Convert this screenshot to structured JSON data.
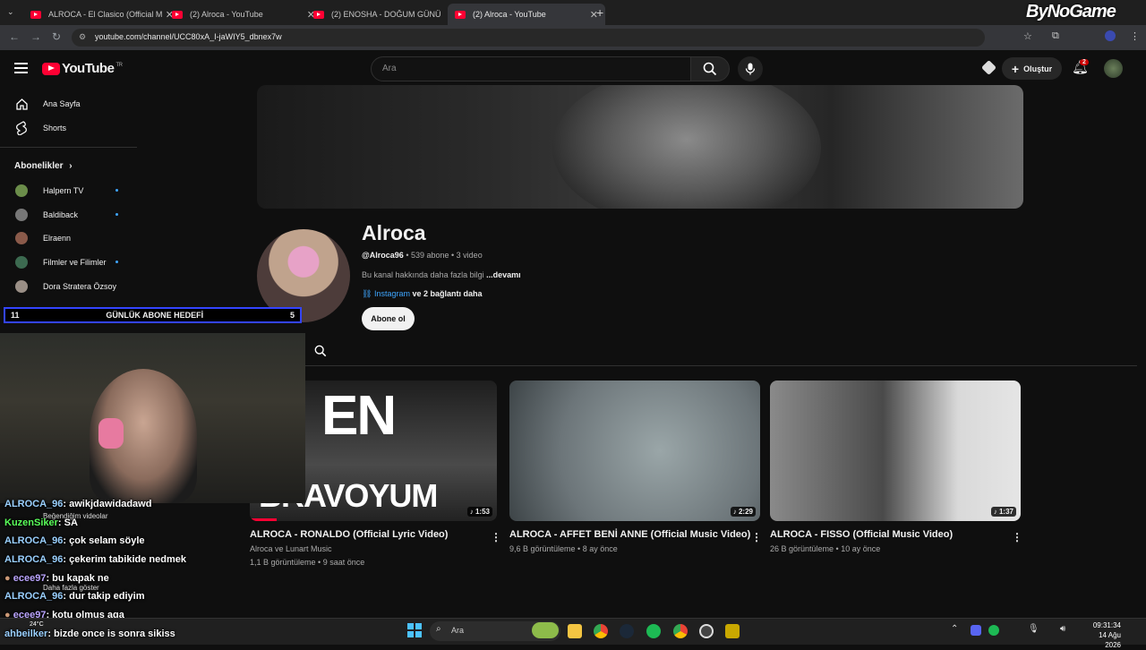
{
  "browser": {
    "tabs": [
      {
        "title": "ALROCA - El Clasico (Official M..."
      },
      {
        "title": "(2) Alroca - YouTube"
      },
      {
        "title": "(2) ENOSHA - DOĞUM GÜNÜ"
      },
      {
        "title": "(2) Alroca - YouTube"
      }
    ],
    "url": "youtube.com/channel/UCC80xA_I-jaWIY5_dbnex7w"
  },
  "watermark": "ByNoGame",
  "youtube": {
    "logo_text": "YouTube",
    "region": "TR",
    "search_placeholder": "Ara",
    "create_label": "Oluştur",
    "notif_count": "2",
    "sidebar": {
      "home": "Ana Sayfa",
      "shorts": "Shorts",
      "subs_header": "Abonelikler",
      "subs": [
        "Halpern TV",
        "Baldiback",
        "Elraenn",
        "Filmler ve Filimler",
        "Dora Stratera Özsoy"
      ],
      "liked": "Beğendiğim videolar",
      "more": "Daha fazla göster"
    },
    "channel": {
      "name": "Alroca",
      "handle": "@Alroca96",
      "subs": "539 abone",
      "videos": "3 video",
      "about": "Bu kanal hakkında daha fazla bilgi",
      "more": "...devamı",
      "link": "Instagram",
      "link_more": "ve 2 bağlantı daha",
      "subscribe": "Abone ol"
    },
    "videos": [
      {
        "title": "ALROCA - RONALDO (Official Lyric Video)",
        "channel": "Alroca ve Lunart Music",
        "views": "1,1 B görüntüleme",
        "age": "9 saat önce",
        "duration": "1:53",
        "thumb_text_top": "EN",
        "thumb_text_bottom": "BRAVOYUM"
      },
      {
        "title": "ALROCA - AFFET BENİ ANNE (Official Music Video)",
        "views": "9,6 B görüntüleme",
        "age": "8 ay önce",
        "duration": "2:29"
      },
      {
        "title": "ALROCA - FISSO (Official Music Video)",
        "views": "26 B görüntüleme",
        "age": "10 ay önce",
        "duration": "1:37"
      }
    ]
  },
  "overlay": {
    "goal_left": "11",
    "goal_label": "GÜNLÜK ABONE HEDEFİ",
    "goal_right": "5",
    "chat": [
      {
        "user": "ALROCA_96",
        "msg": ": awikjdawidadawd"
      },
      {
        "user": "KuzenSiker",
        "msg": ": SA"
      },
      {
        "user": "ALROCA_96",
        "msg": ": çok selam söyle"
      },
      {
        "user": "ALROCA_96",
        "msg": ": çekerim tabikide nedmek"
      },
      {
        "user": "ecee97",
        "msg": ": bu kapak ne"
      },
      {
        "user": "ALROCA_96",
        "msg": ": dur takip ediyim"
      },
      {
        "user": "ecee97",
        "msg": ": kotu olmus aga"
      },
      {
        "user": "ahbeilker",
        "msg": ": bizde once is sonra sikiss"
      }
    ]
  },
  "taskbar": {
    "search": "Ara",
    "weather": "24°C",
    "time": "09:31:34",
    "date": "14 Ağu 2026"
  }
}
